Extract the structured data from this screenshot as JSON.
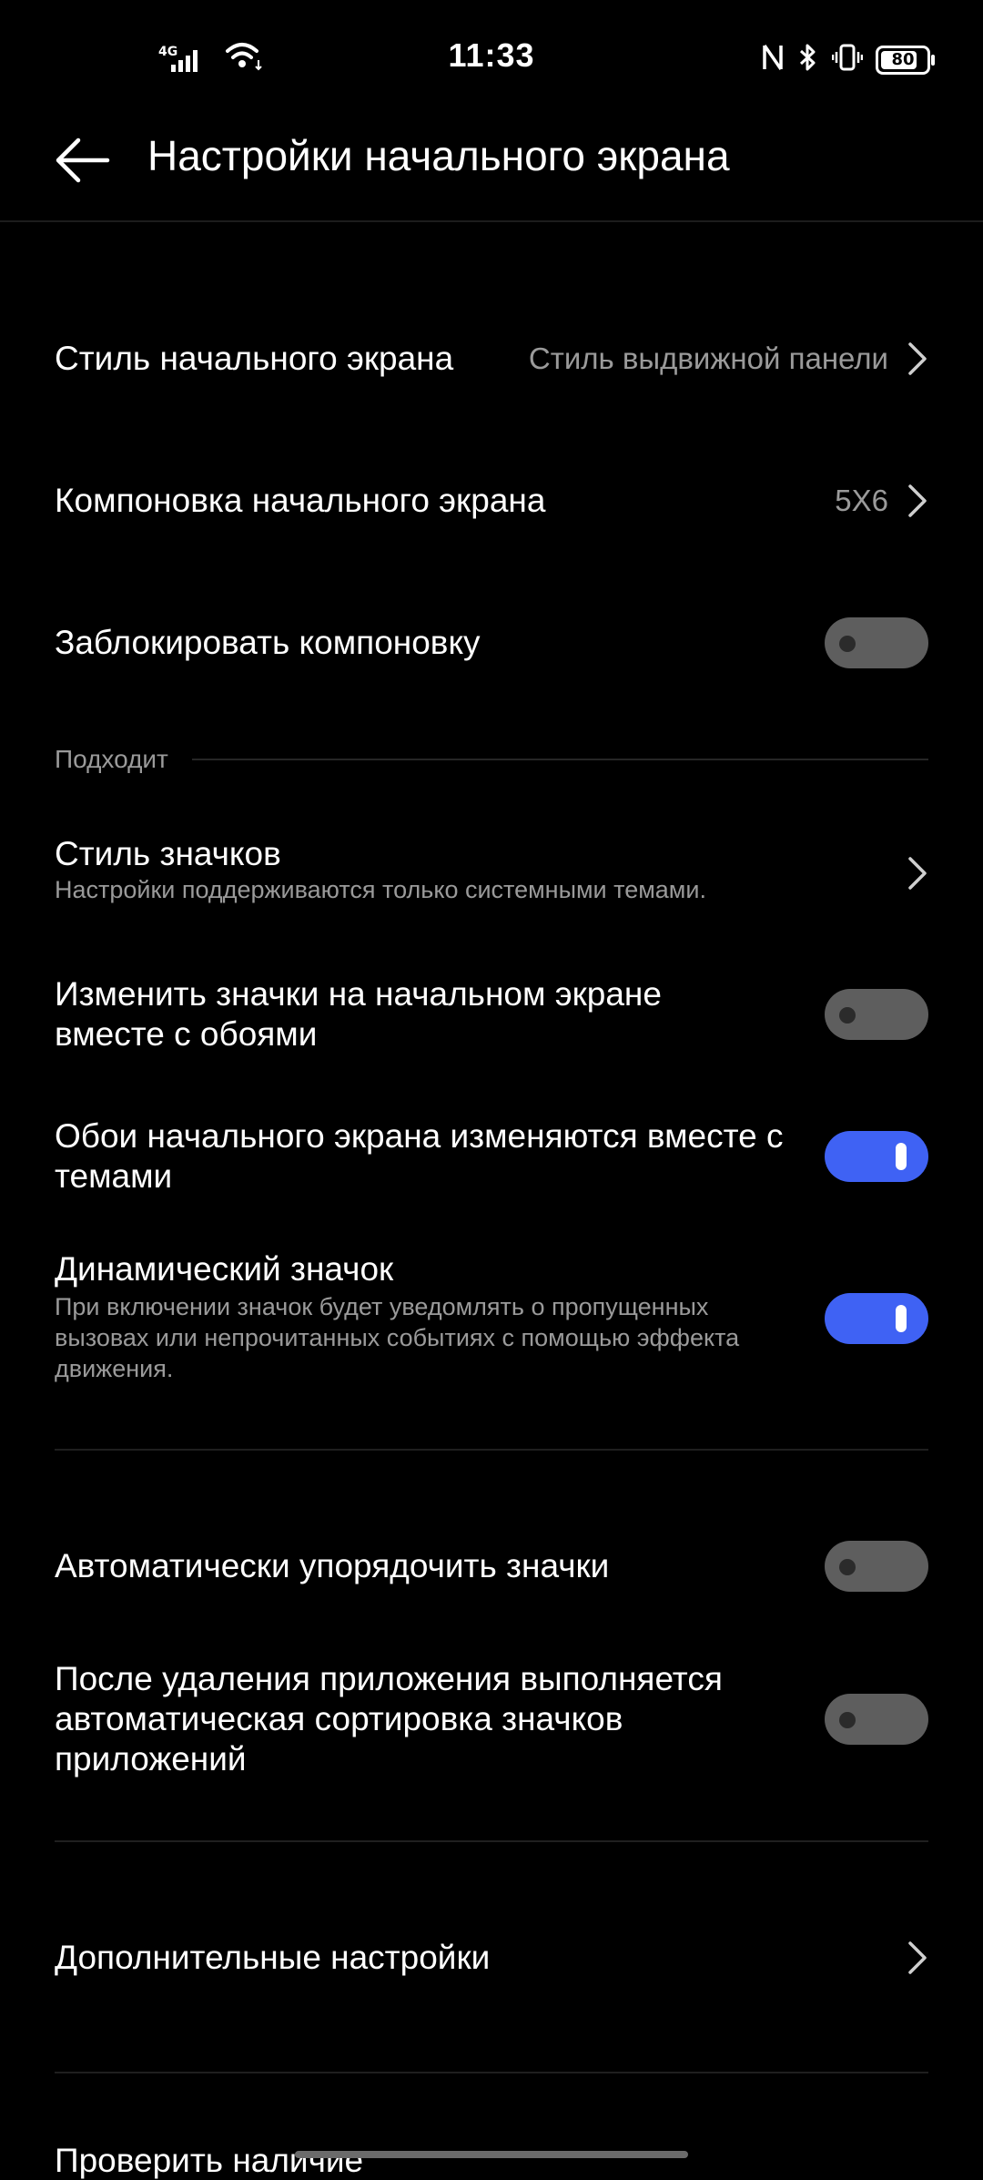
{
  "status_bar": {
    "time": "11:33",
    "network": "4G",
    "battery": "80",
    "icons": [
      "signal-icon",
      "wifi-icon",
      "nfc-icon",
      "bluetooth-icon",
      "vibrate-icon",
      "battery-icon"
    ]
  },
  "header": {
    "title": "Настройки начального экрана",
    "back_icon": "arrow-left-icon"
  },
  "settings": {
    "home_style": {
      "title": "Стиль начального экрана",
      "value": "Стиль выдвижной панели"
    },
    "home_layout": {
      "title": "Компоновка начального экрана",
      "value": "5X6"
    },
    "lock_layout": {
      "title": "Заблокировать компоновку",
      "enabled": false
    },
    "section_header": "Подходит",
    "icon_style": {
      "title": "Стиль значков",
      "subtitle": "Настройки поддерживаются только системными темами."
    },
    "icons_with_wallpaper": {
      "title": "Изменить значки на начальном экране вместе с обоями",
      "enabled": false
    },
    "wallpaper_with_themes": {
      "title": "Обои начального экрана изменяются вместе с темами",
      "enabled": true
    },
    "dynamic_icon": {
      "title": "Динамический значок",
      "subtitle": "При включении значок будет уведомлять о пропущенных вызовах или непрочитанных событиях с помощью эффекта движения.",
      "enabled": true
    },
    "auto_arrange": {
      "title": "Автоматически упорядочить значки",
      "enabled": false
    },
    "auto_sort_after_uninstall": {
      "title": "После удаления приложения выполняется автоматическая сортировка значков приложений",
      "enabled": false
    },
    "additional": {
      "title": "Дополнительные настройки"
    },
    "check_updates": {
      "title": "Проверить наличие"
    }
  },
  "colors": {
    "background": "#000000",
    "accent": "#3f62f4",
    "toggle_off": "#5e5e5e",
    "secondary_text": "#9a9a9a"
  }
}
